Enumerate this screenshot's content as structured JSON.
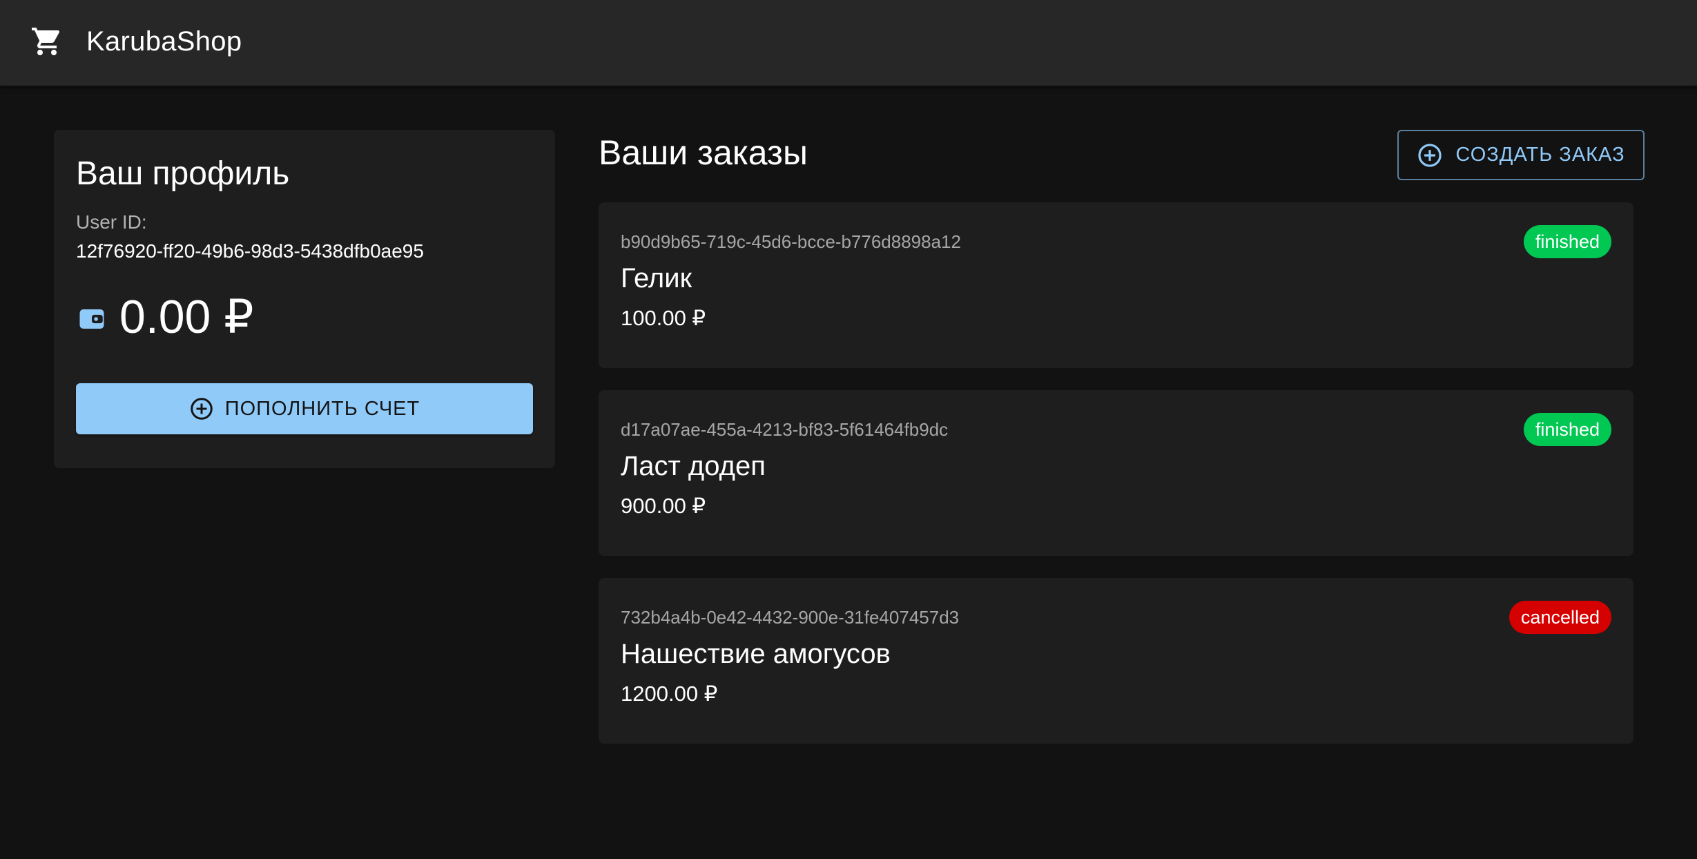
{
  "app": {
    "brand": "KarubaShop",
    "cart_icon": "shopping-cart-icon"
  },
  "profile": {
    "title": "Ваш профиль",
    "user_id_label": "User ID:",
    "user_id": "12f76920-ff20-49b6-98d3-5438dfb0ae95",
    "wallet_icon": "wallet-icon",
    "balance": "0.00 ₽",
    "topup_label": "ПОПОЛНИТЬ СЧЕТ"
  },
  "orders": {
    "title": "Ваши заказы",
    "create_label": "СОЗДАТЬ ЗАКАЗ",
    "items": [
      {
        "id": "b90d9b65-719c-45d6-bcce-b776d8898a12",
        "name": "Гелик",
        "price": "100.00 ₽",
        "status": "finished"
      },
      {
        "id": "d17a07ae-455a-4213-bf83-5f61464fb9dc",
        "name": "Ласт додеп",
        "price": "900.00 ₽",
        "status": "finished"
      },
      {
        "id": "732b4a4b-0e42-4432-900e-31fe407457d3",
        "name": "Нашествие амогусов",
        "price": "1200.00 ₽",
        "status": "cancelled"
      }
    ]
  },
  "colors": {
    "background": "#121212",
    "appbar": "#272727",
    "card": "#1e1e1e",
    "primary": "#90caf9",
    "finished": "#00c853",
    "cancelled": "#d50000"
  }
}
